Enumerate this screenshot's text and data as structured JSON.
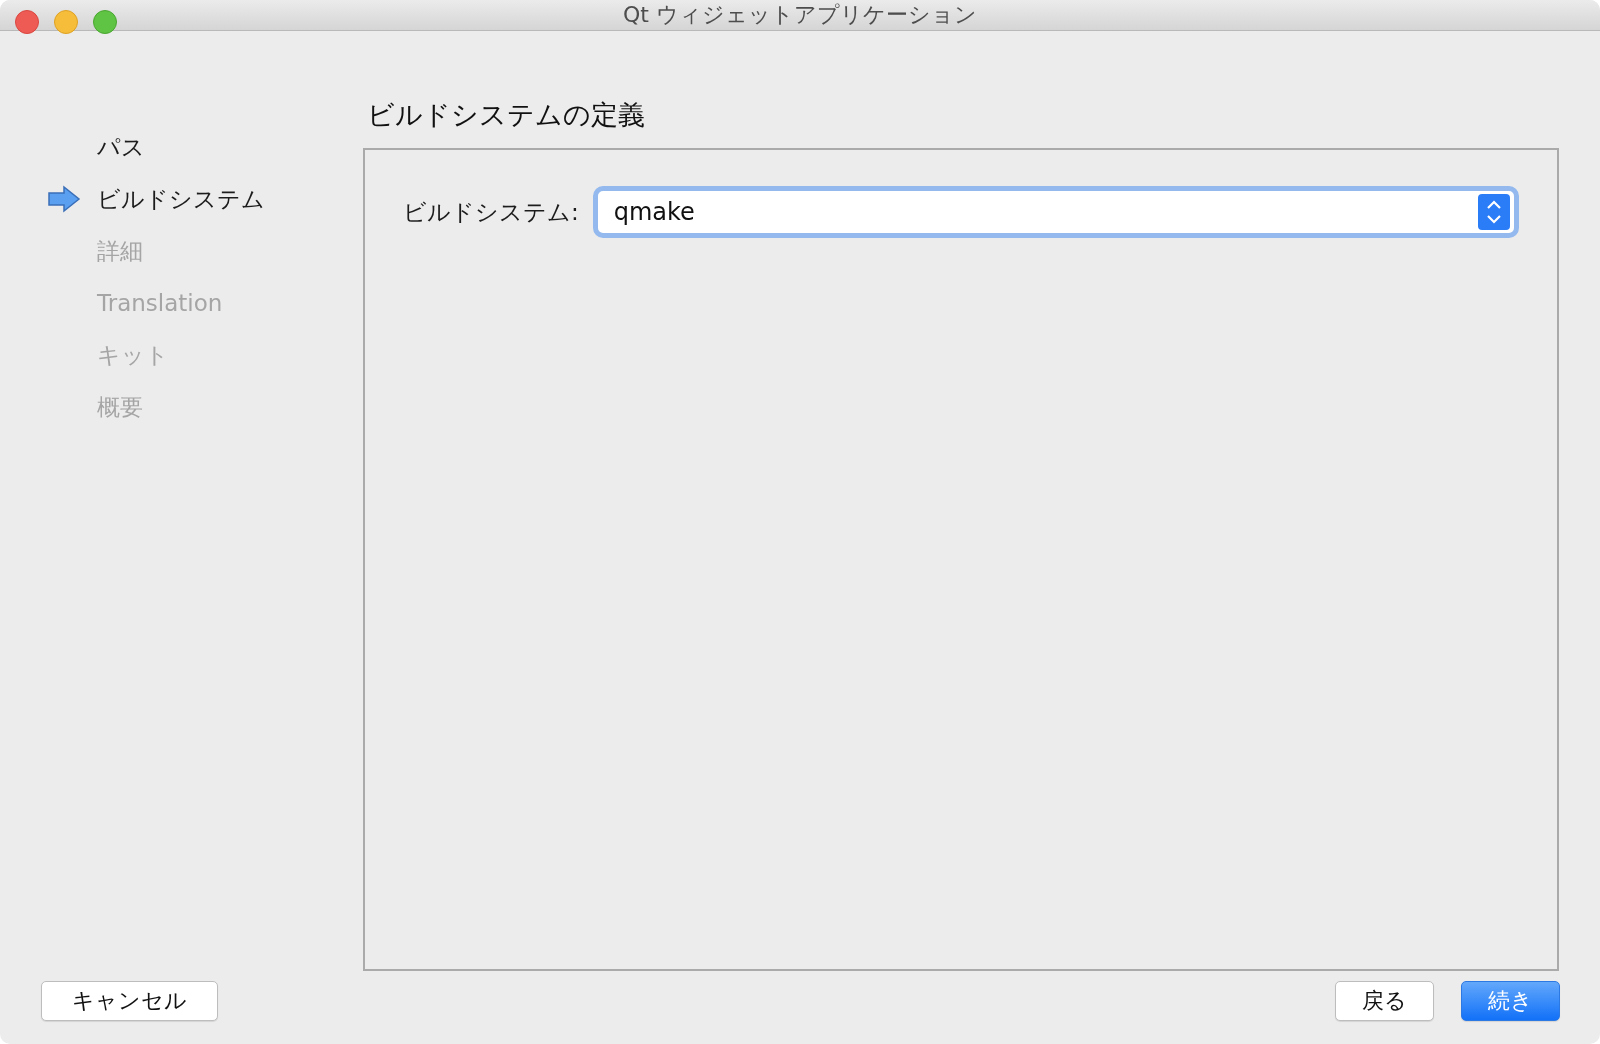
{
  "window": {
    "title": "Qt ウィジェットアプリケーション"
  },
  "steps": [
    {
      "label": "パス",
      "selected": false,
      "disabled": false
    },
    {
      "label": "ビルドシステム",
      "selected": true,
      "disabled": false
    },
    {
      "label": "詳細",
      "selected": false,
      "disabled": true
    },
    {
      "label": "Translation",
      "selected": false,
      "disabled": true
    },
    {
      "label": "キット",
      "selected": false,
      "disabled": true
    },
    {
      "label": "概要",
      "selected": false,
      "disabled": true
    }
  ],
  "page": {
    "heading": "ビルドシステムの定義",
    "field_label": "ビルドシステム:",
    "combo": {
      "value": "qmake"
    }
  },
  "buttons": [
    {
      "label": "キャンセル",
      "kind": "normal"
    },
    {
      "label": "戻る",
      "kind": "normal"
    },
    {
      "label": "続き",
      "kind": "default"
    }
  ]
}
